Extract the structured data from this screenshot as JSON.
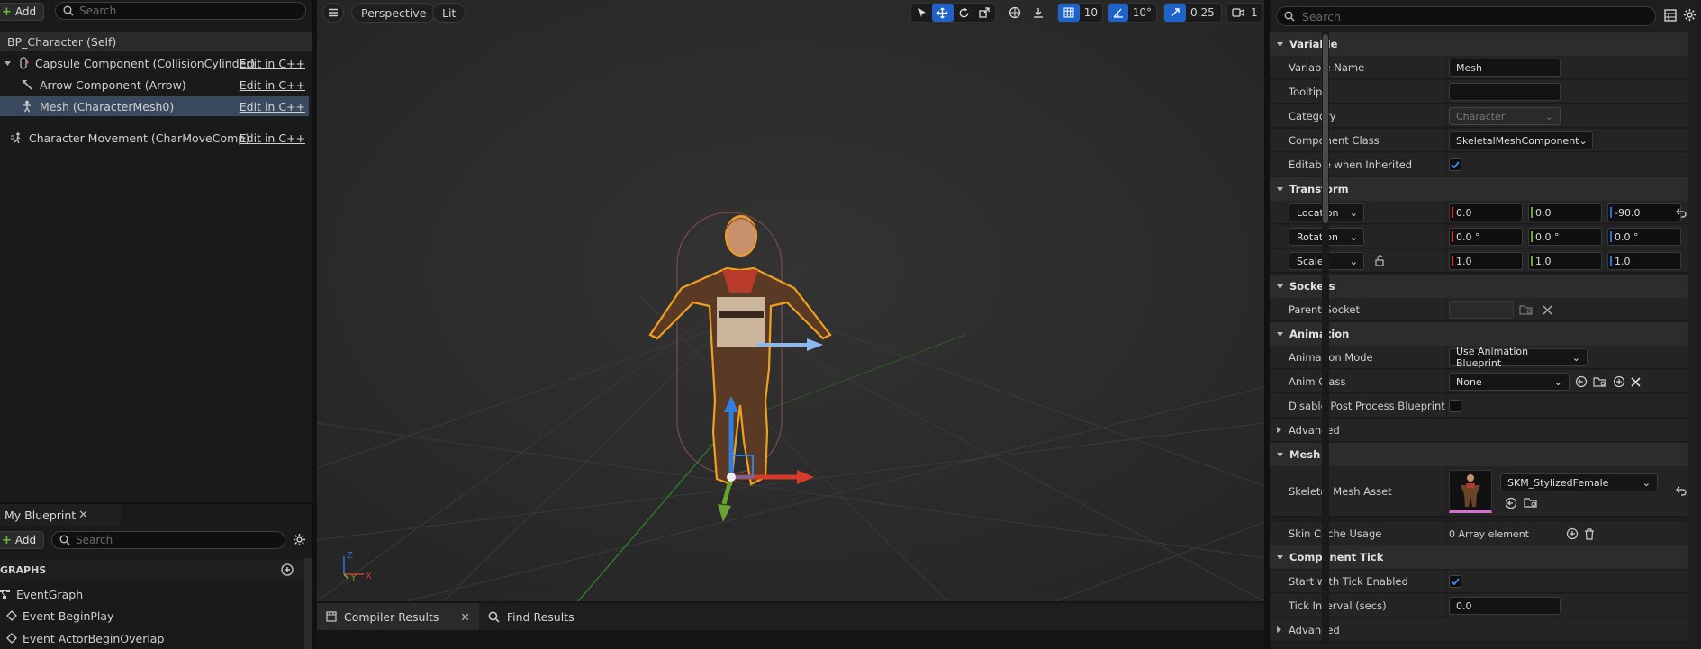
{
  "components": {
    "add_label": "Add",
    "search_placeholder": "Search",
    "root": "BP_Character (Self)",
    "items": [
      {
        "label": "Capsule Component (CollisionCylinder)",
        "edit": "Edit in C++"
      },
      {
        "label": "Arrow Component (Arrow)",
        "edit": "Edit in C++"
      },
      {
        "label": "Mesh (CharacterMesh0)",
        "edit": "Edit in C++"
      },
      {
        "label": "Character Movement (CharMoveComp)",
        "edit": "Edit in C++"
      }
    ]
  },
  "my_blueprint": {
    "tab_label": "My Blueprint",
    "add_label": "Add",
    "search_placeholder": "Search",
    "section": "GRAPHS",
    "items": [
      "EventGraph",
      "Event BeginPlay",
      "Event ActorBeginOverlap"
    ]
  },
  "viewport": {
    "perspective_label": "Perspective",
    "lit_label": "Lit",
    "grid_value": "10",
    "rotation_value": "10°",
    "scale_value": "0.25",
    "camera_value": "1"
  },
  "bottom_tabs": [
    "Compiler Results",
    "Find Results"
  ],
  "details": {
    "search_placeholder": "Search",
    "sections": {
      "variable": "Variable",
      "transform": "Transform",
      "sockets": "Sockets",
      "animation": "Animation",
      "mesh": "Mesh",
      "component_tick": "Component Tick"
    },
    "variable": {
      "name_label": "Variable Name",
      "name_value": "Mesh",
      "tooltip_label": "Tooltip",
      "tooltip_value": "",
      "category_label": "Category",
      "category_value": "Character",
      "class_label": "Component Class",
      "class_value": "SkeletalMeshComponent",
      "editable_label": "Editable when Inherited",
      "editable_checked": true
    },
    "transform": {
      "location_label": "Location",
      "location": [
        "0.0",
        "0.0",
        "-90.0"
      ],
      "rotation_label": "Rotation",
      "rotation": [
        "0.0 °",
        "0.0 °",
        "0.0 °"
      ],
      "scale_label": "Scale",
      "scale": [
        "1.0",
        "1.0",
        "1.0"
      ]
    },
    "sockets": {
      "parent_label": "Parent Socket",
      "parent_value": ""
    },
    "animation": {
      "mode_label": "Animation Mode",
      "mode_value": "Use Animation Blueprint",
      "class_label": "Anim Class",
      "class_value": "None",
      "disable_label": "Disable Post Process Blueprint",
      "disable_checked": false,
      "advanced_label": "Advanced"
    },
    "mesh": {
      "asset_label": "Skeletal Mesh Asset",
      "asset_value": "SKM_StylizedFemale",
      "skin_label": "Skin Cache Usage",
      "skin_value": "0 Array element"
    },
    "component_tick": {
      "start_label": "Start with Tick Enabled",
      "start_checked": true,
      "interval_label": "Tick Interval (secs)",
      "interval_value": "0.0",
      "advanced_label": "Advanced"
    }
  },
  "colors": {
    "selection": "#3a4a5e",
    "accent_blue": "#1d63c9",
    "add_green": "#6fc13c",
    "axis_x": "#d8392b",
    "axis_y": "#6da833",
    "axis_z": "#2e6fd8",
    "outline": "#f0a020"
  }
}
